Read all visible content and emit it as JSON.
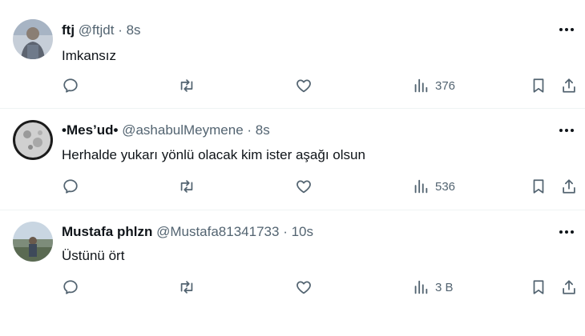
{
  "tweets": [
    {
      "name": "ftj",
      "handle": "@ftjdt",
      "separator": "·",
      "time": "8s",
      "text": "Imkansız",
      "views": "376",
      "avatar_colors": [
        "#a7b4c4",
        "#5d6470"
      ]
    },
    {
      "name": "•Mes’ud•",
      "handle": "@ashabulMeymene",
      "separator": "·",
      "time": "8s",
      "text": "Herhalde yukarı yönlü olacak kim ister aşağı olsun",
      "views": "536",
      "avatar_colors": [
        "#d9d9d9",
        "#222222"
      ]
    },
    {
      "name": "Mustafa phlzn",
      "handle": "@Mustafa81341733",
      "separator": "·",
      "time": "10s",
      "text": "Üstünü ört",
      "views": "3 B",
      "avatar_colors": [
        "#aebfcf",
        "#5a6a52"
      ]
    }
  ],
  "icons": {
    "reply": "reply-icon",
    "retweet": "retweet-icon",
    "like": "like-icon",
    "views": "views-icon",
    "bookmark": "bookmark-icon",
    "share": "share-icon",
    "more": "more-icon"
  },
  "colors": {
    "text": "#0f1419",
    "secondary": "#536471",
    "divider": "#eff3f4"
  }
}
